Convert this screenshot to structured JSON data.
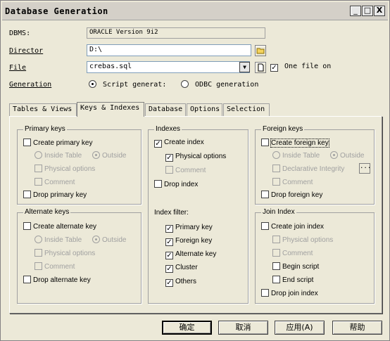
{
  "window": {
    "title": "Database Generation"
  },
  "titlebar_buttons": {
    "minimize": "_",
    "maximize": "□",
    "close": "X"
  },
  "form": {
    "dbms_label": "DBMS:",
    "dbms_value": "ORACLE Version 9i2",
    "directory_label": "Director",
    "directory_value": "D:\\",
    "file_label": "File",
    "file_value": "crebas.sql",
    "one_file_label": "One file on",
    "generation_label": "Generation",
    "gen_script_label": "Script generat:",
    "gen_odbc_label": "ODBC generation"
  },
  "tabs": [
    {
      "label": "Tables & Views"
    },
    {
      "label": "Keys & Indexes"
    },
    {
      "label": "Database"
    },
    {
      "label": "Options"
    },
    {
      "label": "Selection"
    }
  ],
  "primary_keys": {
    "title": "Primary keys",
    "create": "Create primary key",
    "inside": "Inside Table",
    "outside": "Outside",
    "physical": "Physical options",
    "comment": "Comment",
    "drop": "Drop primary key"
  },
  "alternate_keys": {
    "title": "Alternate keys",
    "create": "Create alternate key",
    "inside": "Inside Table",
    "outside": "Outside",
    "physical": "Physical options",
    "comment": "Comment",
    "drop": "Drop alternate key"
  },
  "indexes": {
    "title": "Indexes",
    "create": "Create index",
    "physical": "Physical options",
    "comment": "Comment",
    "drop": "Drop index"
  },
  "index_filter": {
    "title": "Index filter:",
    "items": [
      "Primary key",
      "Foreign key",
      "Alternate key",
      "Cluster",
      "Others"
    ]
  },
  "foreign_keys": {
    "title": "Foreign keys",
    "create": "Create foreign key",
    "inside": "Inside Table",
    "outside": "Outside",
    "declarative": "Declarative Integrity",
    "ellipsis": "...",
    "comment": "Comment",
    "drop": "Drop foreign key"
  },
  "join_index": {
    "title": "Join Index",
    "create": "Create join index",
    "physical": "Physical options",
    "comment": "Comment",
    "begin": "Begin script",
    "end": "End script",
    "drop": "Drop join index"
  },
  "buttons": {
    "ok": "确定",
    "cancel": "取消",
    "apply": "应用(A)",
    "help": "帮助"
  },
  "check_mark": "✓"
}
